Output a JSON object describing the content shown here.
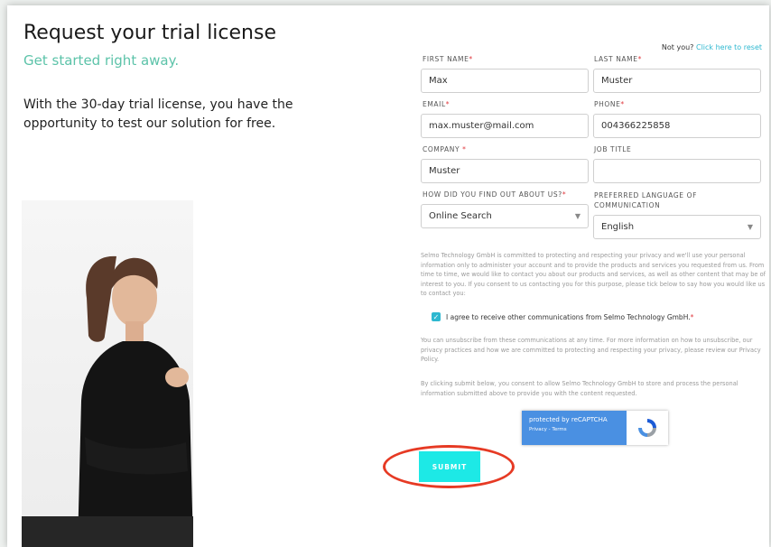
{
  "header": {
    "title": "Request your trial license",
    "subtitle": "Get started right away.",
    "intro": "With the 30-day trial license, you have the opportunity to test our solution for free."
  },
  "not_you": {
    "text": "Not you?",
    "link": "Click here to reset"
  },
  "form": {
    "first_name": {
      "label": "FIRST NAME",
      "value": "Max"
    },
    "last_name": {
      "label": "LAST NAME",
      "value": "Muster"
    },
    "email": {
      "label": "EMAIL",
      "value": "max.muster@mail.com"
    },
    "phone": {
      "label": "PHONE",
      "value": "004366225858"
    },
    "company": {
      "label": "COMPANY ",
      "value": "Muster"
    },
    "job_title": {
      "label": "JOB TITLE",
      "value": ""
    },
    "found_us": {
      "label": "HOW DID YOU FIND OUT ABOUT US?",
      "value": "Online Search"
    },
    "language": {
      "label": "PREFERRED LANGUAGE OF COMMUNICATION",
      "value": "English"
    },
    "required_mark": "*"
  },
  "privacy_text": "Selmo Technology GmbH is committed to protecting and respecting your privacy and we'll use your personal information only to administer your account and to provide the products and services you requested from us. From time to time, we would like to contact you about our products and services, as well as other content that may be of interest to you. If you consent to us contacting you for this purpose, please tick below to say how you would like us to contact you:",
  "consent_checkbox": {
    "label": "I agree to receive other communications from Selmo Technology GmbH.",
    "checked": true
  },
  "unsubscribe_text": "You can unsubscribe from these communications at any time. For more information on how to unsubscribe, our privacy practices and how we are committed to protecting and respecting your privacy, please review our Privacy Policy.",
  "submit_consent_text": "By clicking submit below, you consent to allow Selmo Technology GmbH to store and process the personal information submitted above to provide you with the content requested.",
  "recaptcha": {
    "title": "protected by reCAPTCHA",
    "links": "Privacy - Terms"
  },
  "submit_label": "SUBMIT",
  "colors": {
    "accent": "#2eb8d0",
    "subtitle": "#5cc3a9",
    "submit_bg": "#1de9e6",
    "highlight": "#e63a24"
  }
}
